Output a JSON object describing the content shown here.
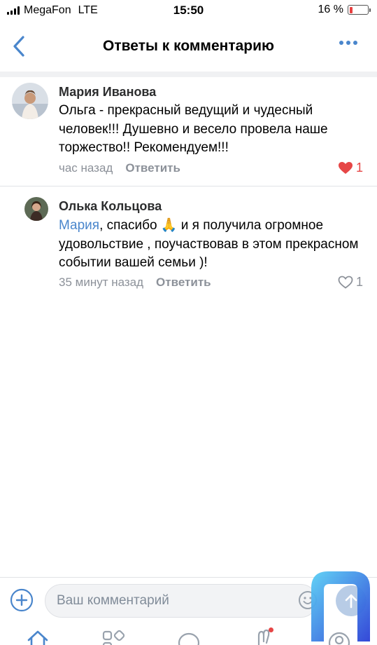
{
  "status_bar": {
    "carrier": "MegaFon",
    "network": "LTE",
    "time": "15:50",
    "battery": "16 %",
    "battery_level": 0.16
  },
  "header": {
    "title": "Ответы к комментарию"
  },
  "comments": [
    {
      "author": "Мария Иванова",
      "text": "Ольга - прекрасный ведущий и чудесный человек!!! Душевно и весело провела наше торжество!! Рекомендуем!!!",
      "time": "час назад",
      "reply_label": "Ответить",
      "likes": "1",
      "liked": true
    },
    {
      "author": "Олька Кольцова",
      "mention": "Мария",
      "text": ", спасибо 🙏 и я получила огромное удовольствие , поучаствовав в этом прекрасном событии вашей семьи )!",
      "time": "35 минут назад",
      "reply_label": "Ответить",
      "likes": "1",
      "liked": false
    }
  ],
  "input": {
    "placeholder": "Ваш комментарий"
  },
  "colors": {
    "accent": "#4a86cc",
    "like_red": "#e64646",
    "meta_gray": "#8c9199"
  }
}
